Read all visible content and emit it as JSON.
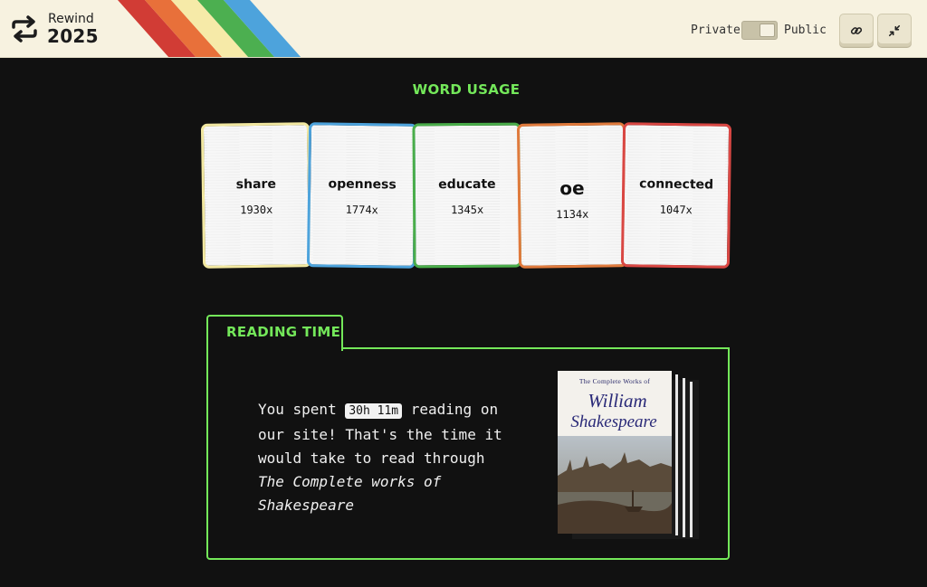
{
  "header": {
    "brand_name": "Rewind",
    "brand_year": "2025",
    "visibility": {
      "private_label": "Private",
      "public_label": "Public",
      "selected": "Public"
    },
    "stripe_colors": [
      "#d13c35",
      "#e8703a",
      "#f6eaa8",
      "#4caf50",
      "#4da3dc"
    ],
    "buttons": [
      {
        "icon": "link-icon"
      },
      {
        "icon": "collapse-icon"
      }
    ]
  },
  "word_usage": {
    "title": "WORD USAGE",
    "words": [
      {
        "word": "share",
        "count": "1930x",
        "color": "#f2e8a1"
      },
      {
        "word": "openness",
        "count": "1774x",
        "color": "#4da3dc"
      },
      {
        "word": "educate",
        "count": "1345x",
        "color": "#4aad4a"
      },
      {
        "word": "oe",
        "count": "1134x",
        "color": "#e07a3c"
      },
      {
        "word": "connected",
        "count": "1047x",
        "color": "#d94743"
      }
    ]
  },
  "reading_time": {
    "title": "READING TIME",
    "prefix": "You spent ",
    "duration": "30h 11m",
    "middle": " reading on our site! That's the time it would take to read through ",
    "book_name": "The Complete works of Shakespeare",
    "book_cover": {
      "top_line": "The Complete Works of",
      "line1": "William",
      "line2": "Shakespeare"
    }
  },
  "accent_color": "#74e85a"
}
